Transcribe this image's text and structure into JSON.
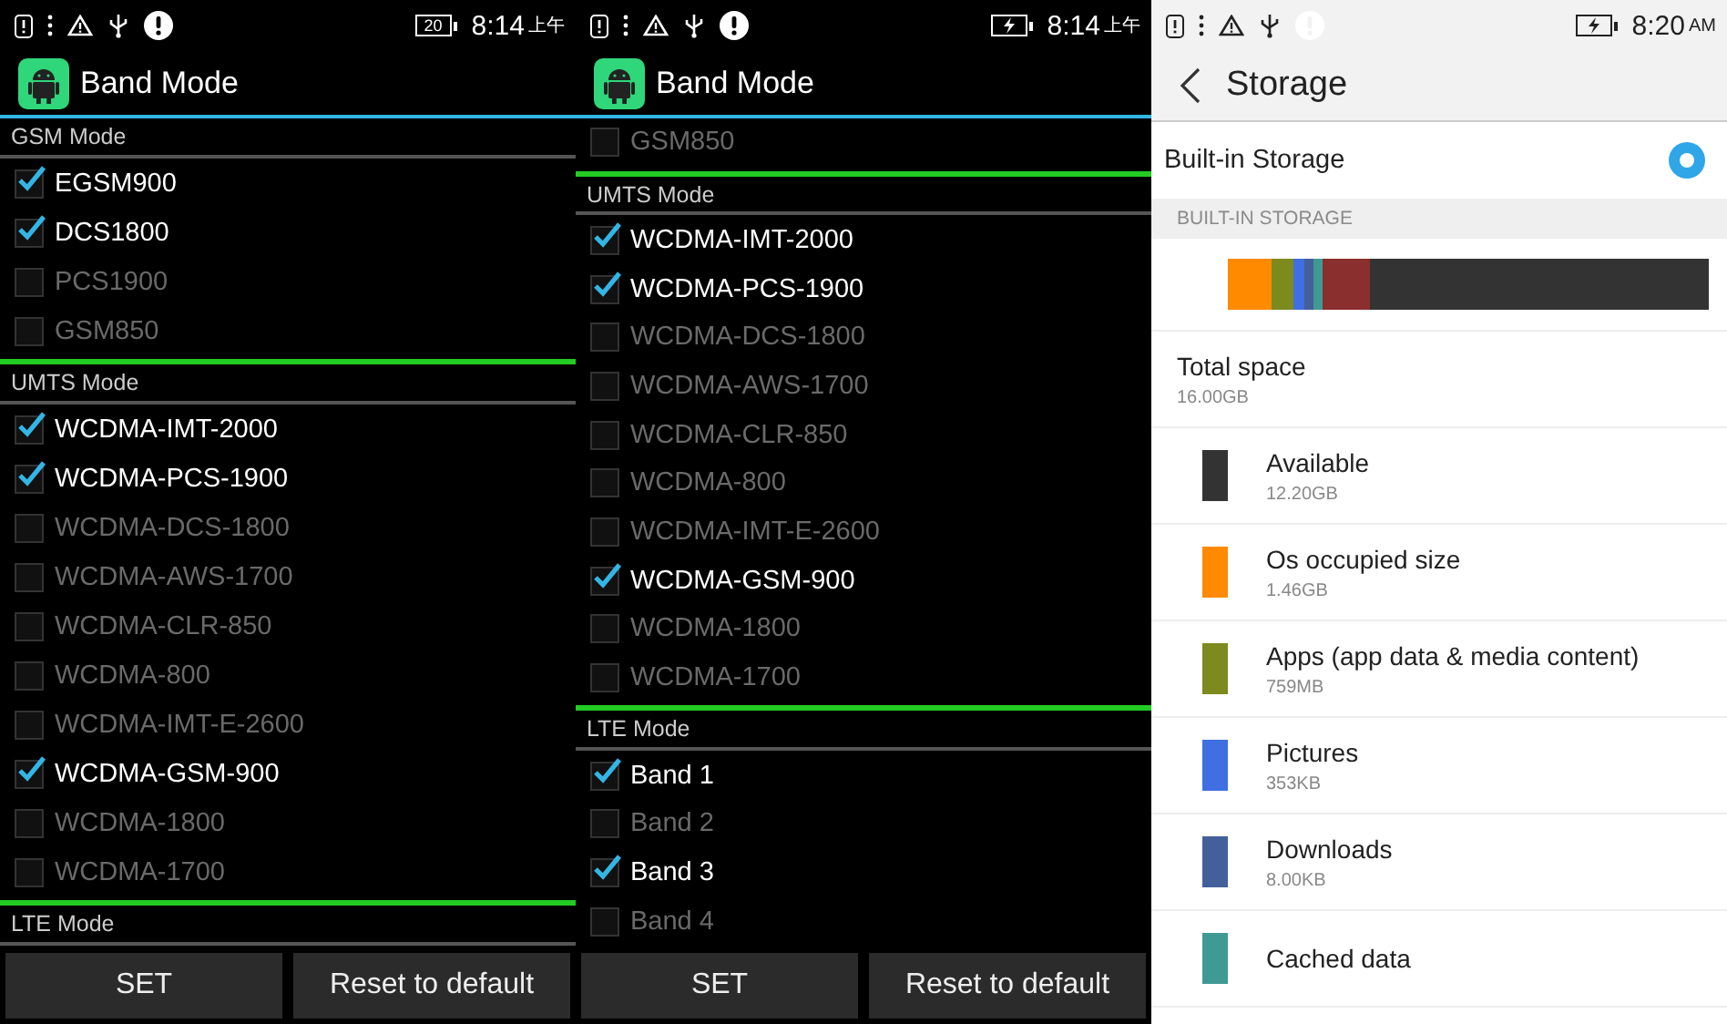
{
  "panels": [
    {
      "kind": "band",
      "status_bar": {
        "battery_label": "20",
        "charging": false,
        "time": "8:14",
        "period": "上午"
      },
      "title": "Band Mode",
      "sections": [
        {
          "title": "GSM Mode",
          "items": [
            {
              "label": "EGSM900",
              "checked": true
            },
            {
              "label": "DCS1800",
              "checked": true
            },
            {
              "label": "PCS1900",
              "checked": false
            },
            {
              "label": "GSM850",
              "checked": false
            }
          ]
        },
        {
          "title": "UMTS Mode",
          "items": [
            {
              "label": "WCDMA-IMT-2000",
              "checked": true
            },
            {
              "label": "WCDMA-PCS-1900",
              "checked": true
            },
            {
              "label": "WCDMA-DCS-1800",
              "checked": false
            },
            {
              "label": "WCDMA-AWS-1700",
              "checked": false
            },
            {
              "label": "WCDMA-CLR-850",
              "checked": false
            },
            {
              "label": "WCDMA-800",
              "checked": false
            },
            {
              "label": "WCDMA-IMT-E-2600",
              "checked": false
            },
            {
              "label": "WCDMA-GSM-900",
              "checked": true
            },
            {
              "label": "WCDMA-1800",
              "checked": false
            },
            {
              "label": "WCDMA-1700",
              "checked": false
            }
          ]
        },
        {
          "title": "LTE Mode"
        }
      ],
      "buttons": [
        "SET",
        "Reset to default"
      ]
    },
    {
      "kind": "band",
      "status_bar": {
        "charging": true,
        "time": "8:14",
        "period": "上午"
      },
      "title": "Band Mode",
      "sections": [
        {
          "items": [
            {
              "label": "GSM850",
              "checked": false
            }
          ]
        },
        {
          "title": "UMTS Mode",
          "items": [
            {
              "label": "WCDMA-IMT-2000",
              "checked": true
            },
            {
              "label": "WCDMA-PCS-1900",
              "checked": true
            },
            {
              "label": "WCDMA-DCS-1800",
              "checked": false
            },
            {
              "label": "WCDMA-AWS-1700",
              "checked": false
            },
            {
              "label": "WCDMA-CLR-850",
              "checked": false
            },
            {
              "label": "WCDMA-800",
              "checked": false
            },
            {
              "label": "WCDMA-IMT-E-2600",
              "checked": false
            },
            {
              "label": "WCDMA-GSM-900",
              "checked": true
            },
            {
              "label": "WCDMA-1800",
              "checked": false
            },
            {
              "label": "WCDMA-1700",
              "checked": false
            }
          ]
        },
        {
          "title": "LTE Mode",
          "items": [
            {
              "label": "Band 1",
              "checked": true
            },
            {
              "label": "Band 2",
              "checked": false
            },
            {
              "label": "Band 3",
              "checked": true
            },
            {
              "label": "Band 4",
              "checked": false
            }
          ]
        }
      ],
      "buttons": [
        "SET",
        "Reset to default"
      ]
    },
    {
      "kind": "storage",
      "status_bar": {
        "charging": true,
        "time": "8:20",
        "period": "AM"
      },
      "title": "Storage",
      "volume": {
        "label": "Built-in Storage",
        "selected": true
      },
      "section_header": "BUILT-IN STORAGE",
      "total": {
        "label": "Total space",
        "size": "16.00GB"
      },
      "items": [
        {
          "label": "Available",
          "size": "12.20GB",
          "color": "#333333"
        },
        {
          "label": "Os occupied size",
          "size": "1.46GB",
          "color": "#ff8a00"
        },
        {
          "label": "Apps (app data & media content)",
          "size": "759MB",
          "color": "#7d8a1e"
        },
        {
          "label": "Pictures",
          "size": "353KB",
          "color": "#3f6fe0"
        },
        {
          "label": "Downloads",
          "size": "8.00KB",
          "color": "#44609a"
        },
        {
          "label": "Cached data",
          "color": "#3f9a94"
        }
      ]
    }
  ]
}
